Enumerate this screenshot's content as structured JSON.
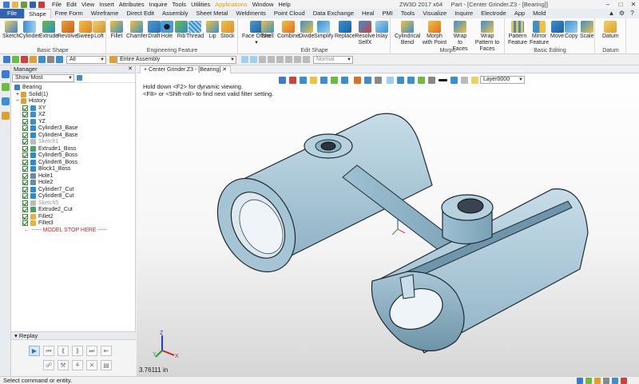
{
  "menu": {
    "items": [
      "File",
      "Edit",
      "View",
      "Insert",
      "Attributes",
      "Inquire",
      "Tools",
      "Utilities",
      "Applications",
      "Window",
      "Help"
    ]
  },
  "window": {
    "app_title": "ZW3D 2017 x64",
    "doc_title": "Part - [Center Grinder.Z3 - [Bearing]]"
  },
  "tabs": [
    "File",
    "Shape",
    "Free Form",
    "Wireframe",
    "Direct Edit",
    "Assembly",
    "Sheet Metal",
    "Weldments",
    "Point Cloud",
    "Data Exchange",
    "Heal",
    "PMI",
    "Tools",
    "Visualize",
    "Inquire",
    "Electrode",
    "App",
    "Mold"
  ],
  "ribbon": {
    "basic_shape": {
      "label": "Basic Shape",
      "buttons": [
        "Sketch",
        "Cylinder",
        "Extrude",
        "Revolve",
        "Sweep",
        "Loft"
      ]
    },
    "engineering": {
      "label": "Engineering Feature",
      "buttons": [
        "Fillet",
        "Chamfer",
        "Draft",
        "Hole",
        "Rib",
        "Thread",
        "Lip",
        "Stock"
      ]
    },
    "edit_shape": {
      "label": "Edit Shape",
      "buttons": [
        "Face Offset",
        "Shell",
        "Combine",
        "Divide",
        "Simplify",
        "Replace",
        "Resolve SelfX",
        "Inlay"
      ],
      "arrow": "▾"
    },
    "morph": {
      "label": "Morph",
      "buttons": [
        "Cylindrical Bend",
        "Morph with Point",
        "Wrap to Faces",
        "Wrap Pattern to Faces"
      ]
    },
    "basic_editing": {
      "label": "Basic Editing",
      "buttons": [
        "Pattern Feature",
        "Mirror Feature",
        "Move",
        "Copy",
        "Scale"
      ]
    },
    "datum": {
      "label": "Datum",
      "buttons": [
        "Datum"
      ]
    }
  },
  "toolbar": {
    "filter_value": "All",
    "scope_value": "Entire Assembly",
    "display_value": "Normal"
  },
  "manager": {
    "title": "Manager",
    "pin": "✕",
    "filter_value": "Show Most",
    "tree": [
      {
        "label": "Bearing",
        "kind": "root"
      },
      {
        "label": "Solid(1)",
        "kind": "folder"
      },
      {
        "label": "History",
        "kind": "folder"
      },
      {
        "label": "XY",
        "kind": "datum"
      },
      {
        "label": "XZ",
        "kind": "datum"
      },
      {
        "label": "YZ",
        "kind": "datum"
      },
      {
        "label": "Cylinder3_Base",
        "kind": "cyl"
      },
      {
        "label": "Cylinder4_Base",
        "kind": "cyl"
      },
      {
        "label": "Sketch1",
        "kind": "sketch"
      },
      {
        "label": "Extrude1_Boss",
        "kind": "extrude"
      },
      {
        "label": "Cylinder5_Boss",
        "kind": "cyl"
      },
      {
        "label": "Cylinder6_Boss",
        "kind": "cyl"
      },
      {
        "label": "Block1_Boss",
        "kind": "block"
      },
      {
        "label": "Hole1",
        "kind": "hole"
      },
      {
        "label": "Hole2",
        "kind": "hole"
      },
      {
        "label": "Cylinder7_Cut",
        "kind": "cyl"
      },
      {
        "label": "Cylinder8_Cut",
        "kind": "cyl"
      },
      {
        "label": "Sketch5",
        "kind": "sketch"
      },
      {
        "label": "Extrude2_Cut",
        "kind": "extrude"
      },
      {
        "label": "Fillet2",
        "kind": "fillet"
      },
      {
        "label": "Fillet3",
        "kind": "fillet"
      },
      {
        "label": "----- MODEL STOP HERE -----",
        "kind": "stop"
      }
    ]
  },
  "replay": {
    "title": "Replay",
    "row1": [
      "▶",
      "⏮",
      "⟪",
      "⟫",
      "⏭",
      "⇤"
    ],
    "row2": [
      "☍",
      "⚒",
      "⚘",
      "✕",
      "▤"
    ]
  },
  "viewport": {
    "doc_tab": "Center Grinder.Z3 - [Bearing]",
    "doc_tab_prefix": "+",
    "layer_value": "Layer0000",
    "hint_line1": "Hold down <F2> for dynamic viewing.",
    "hint_line2": "<F8> or <Shift-roll> to find next valid filter setting.",
    "readout": "3.76111 in",
    "axis_x": "X",
    "axis_y": "Y",
    "axis_z": "Z"
  },
  "status": {
    "message": "Select command or entity."
  },
  "colors": {
    "accent": "#2f63b1",
    "part": "#a9c8d8",
    "part_dark": "#6f95ab",
    "part_edge": "#1d2a33",
    "axis_x": "#d42020",
    "axis_y": "#20a020",
    "axis_z": "#2040d0"
  }
}
